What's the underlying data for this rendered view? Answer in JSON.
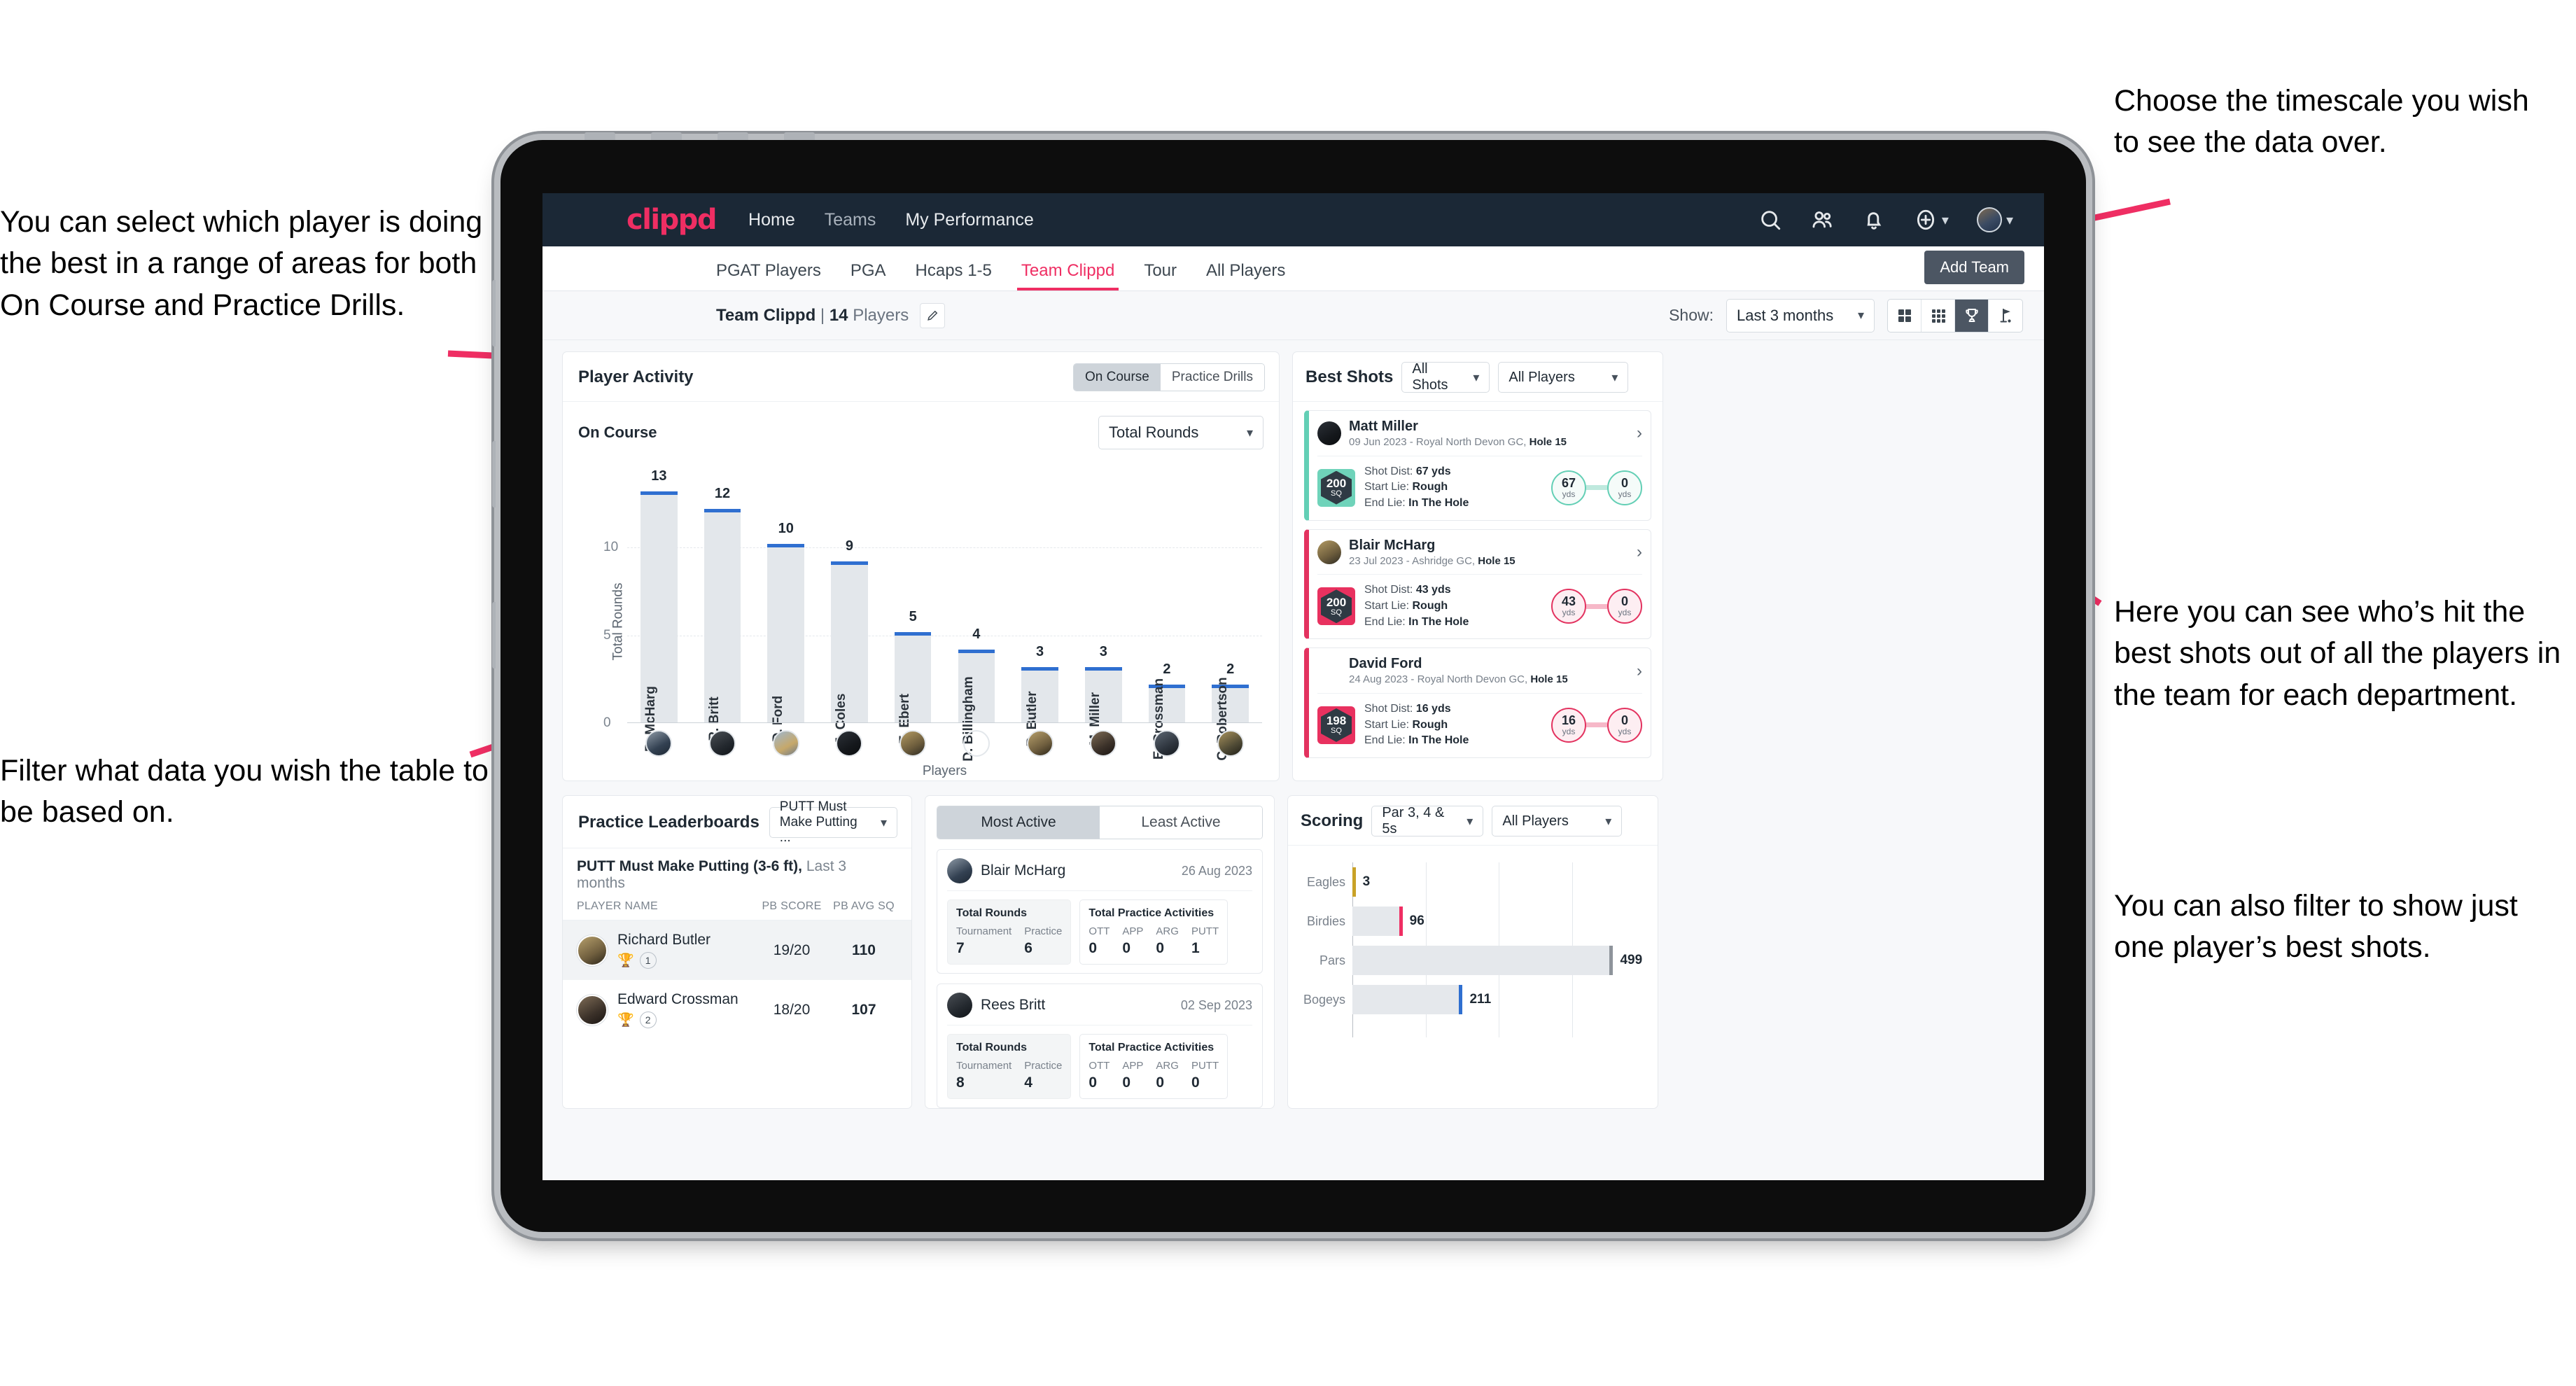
{
  "annotations": {
    "left_top": "You can select which player is doing the best in a range of areas for both On Course and Practice Drills.",
    "left_bottom": "Filter what data you wish the table to be based on.",
    "right_top": "Choose the timescale you wish to see the data over.",
    "right_mid": "Here you can see who’s hit the best shots out of all the players in the team for each department.",
    "right_bottom": "You can also filter to show just one player’s best shots."
  },
  "topnav": {
    "logo": "clippd",
    "links": [
      {
        "label": "Home",
        "dim": false
      },
      {
        "label": "Teams",
        "dim": true
      },
      {
        "label": "My Performance",
        "dim": false
      }
    ],
    "icons": [
      "search-icon",
      "people-icon",
      "bell-icon",
      "plus-circle-icon",
      "avatar-icon"
    ]
  },
  "tabs": [
    {
      "label": "PGAT Players",
      "active": false
    },
    {
      "label": "PGA",
      "active": false
    },
    {
      "label": "Hcaps 1-5",
      "active": false
    },
    {
      "label": "Team Clippd",
      "active": true
    },
    {
      "label": "Tour",
      "active": false
    },
    {
      "label": "All Players",
      "active": false
    }
  ],
  "add_team_button": "Add Team",
  "subbar": {
    "team_name": "Team Clippd",
    "team_count": "14",
    "players_word": "Players",
    "show_label": "Show:",
    "show_value": "Last 3 months",
    "view_toggles": [
      {
        "icon": "grid-4-icon",
        "active": false
      },
      {
        "icon": "grid-9-icon",
        "active": false
      },
      {
        "icon": "trophy-icon",
        "active": true
      },
      {
        "icon": "golf-flag-icon",
        "active": false
      }
    ]
  },
  "player_activity": {
    "title": "Player Activity",
    "segments": [
      {
        "label": "On Course",
        "active": true
      },
      {
        "label": "Practice Drills",
        "active": false
      }
    ],
    "sub_label": "On Course",
    "metric_select": "Total Rounds"
  },
  "chart_data": {
    "type": "bar",
    "title": "Player Activity – On Course",
    "xlabel": "Players",
    "ylabel": "Total Rounds",
    "ylim": [
      0,
      14
    ],
    "yticks": [
      0,
      5,
      10
    ],
    "grid": true,
    "categories": [
      "B. McHarg",
      "R. Britt",
      "D. Ford",
      "J. Coles",
      "E. Ebert",
      "D. Billingham",
      "R. Butler",
      "M. Miller",
      "E. Crossman",
      "C. Robertson"
    ],
    "values": [
      13,
      12,
      10,
      9,
      5,
      4,
      3,
      3,
      2,
      2
    ],
    "bar_color": "#e3e7eb",
    "cap_color": "#2f6fd0"
  },
  "best_shots": {
    "title": "Best Shots",
    "shots_filter": "All Shots",
    "players_filter": "All Players",
    "items": [
      {
        "name": "Matt Miller",
        "meta_date": "09 Jun 2023",
        "meta_course": "Royal North Devon GC,",
        "meta_hole": "Hole 15",
        "badge_value": "200",
        "badge_unit": "SQ",
        "shot_dist_label": "Shot Dist:",
        "shot_dist": "67 yds",
        "start_lie_label": "Start Lie:",
        "start_lie": "Rough",
        "end_lie_label": "End Lie:",
        "end_lie": "In The Hole",
        "from_val": "67",
        "from_unit": "yds",
        "to_val": "0",
        "to_unit": "yds",
        "accent": "#63cfb5",
        "theme": "teal"
      },
      {
        "name": "Blair McHarg",
        "meta_date": "23 Jul 2023",
        "meta_course": "Ashridge GC,",
        "meta_hole": "Hole 15",
        "badge_value": "200",
        "badge_unit": "SQ",
        "shot_dist_label": "Shot Dist:",
        "shot_dist": "43 yds",
        "start_lie_label": "Start Lie:",
        "start_lie": "Rough",
        "end_lie_label": "End Lie:",
        "end_lie": "In The Hole",
        "from_val": "43",
        "from_unit": "yds",
        "to_val": "0",
        "to_unit": "yds",
        "accent": "#e3325f",
        "theme": "pink"
      },
      {
        "name": "David Ford",
        "meta_date": "24 Aug 2023",
        "meta_course": "Royal North Devon GC,",
        "meta_hole": "Hole 15",
        "badge_value": "198",
        "badge_unit": "SQ",
        "shot_dist_label": "Shot Dist:",
        "shot_dist": "16 yds",
        "start_lie_label": "Start Lie:",
        "start_lie": "Rough",
        "end_lie_label": "End Lie:",
        "end_lie": "In The Hole",
        "from_val": "16",
        "from_unit": "yds",
        "to_val": "0",
        "to_unit": "yds",
        "accent": "#e3325f",
        "theme": "pink"
      }
    ]
  },
  "practice_leaderboards": {
    "title": "Practice Leaderboards",
    "drill_select": "PUTT Must Make Putting ...",
    "subtitle_bold": "PUTT Must Make Putting (3-6 ft),",
    "subtitle_rest": " Last 3 months",
    "columns": [
      "PLAYER NAME",
      "PB SCORE",
      "PB AVG SQ"
    ],
    "rows": [
      {
        "name": "Richard Butler",
        "trophy": "gold",
        "rank": "1",
        "pb_score": "19/20",
        "pb_avg_sq": "110"
      },
      {
        "name": "Edward Crossman",
        "trophy": "silver",
        "rank": "2",
        "pb_score": "18/20",
        "pb_avg_sq": "107"
      }
    ]
  },
  "activity": {
    "tabs": [
      {
        "label": "Most Active",
        "active": true
      },
      {
        "label": "Least Active",
        "active": false
      }
    ],
    "rounds_title": "Total Rounds",
    "practice_title": "Total Practice Activities",
    "rounds_cols": [
      "Tournament",
      "Practice"
    ],
    "practice_cols": [
      "OTT",
      "APP",
      "ARG",
      "PUTT"
    ],
    "items": [
      {
        "name": "Blair McHarg",
        "date": "26 Aug 2023",
        "rounds": [
          "7",
          "6"
        ],
        "practice": [
          "0",
          "0",
          "0",
          "1"
        ]
      },
      {
        "name": "Rees Britt",
        "date": "02 Sep 2023",
        "rounds": [
          "8",
          "4"
        ],
        "practice": [
          "0",
          "0",
          "0",
          "0"
        ]
      }
    ]
  },
  "scoring": {
    "title": "Scoring",
    "type_filter": "Par 3, 4 & 5s",
    "players_filter": "All Players"
  },
  "scoring_chart": {
    "type": "bar",
    "orientation": "horizontal",
    "title": "Scoring",
    "categories": [
      "Eagles",
      "Birdies",
      "Pars",
      "Bogeys"
    ],
    "values": [
      3,
      96,
      499,
      211
    ],
    "tip_colors": [
      "#c9a227",
      "#ef2e63",
      "#8e949b",
      "#2f6fd0"
    ],
    "xmax": 560,
    "grid": true
  },
  "colors": {
    "brand_pink": "#ef2e63",
    "navy": "#1b2836",
    "teal": "#63cfb5",
    "blue": "#2f6fd0"
  }
}
